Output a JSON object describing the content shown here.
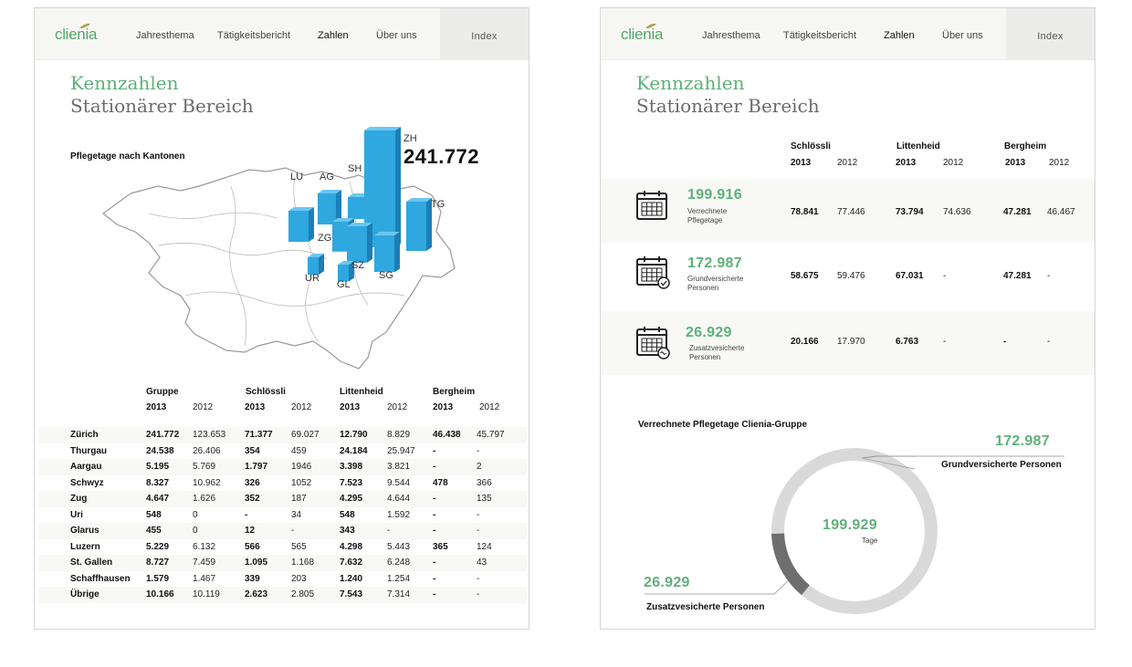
{
  "nav": {
    "logo": "clienia",
    "items": [
      "Jahresthema",
      "Tätigkeitsbericht",
      "Zahlen",
      "Über uns"
    ],
    "active": "Zahlen",
    "index": "Index"
  },
  "title": {
    "line1": "Kennzahlen",
    "line2": "Stationärer Bereich"
  },
  "colors": {
    "accent_green": "#5eb07a",
    "bar_blue": "#2fa7df",
    "donut_light": "#d9d9d9",
    "donut_dark": "#6e6e6e"
  },
  "left": {
    "map_label": "Pflegetage nach Kantonen",
    "map_big_value": "241.772",
    "cantons": [
      "LU",
      "AG",
      "SH",
      "ZH",
      "TG",
      "ZG",
      "UR",
      "SZ",
      "GL",
      "SG"
    ],
    "table": {
      "groups": [
        "Gruppe",
        "Schlössli",
        "Littenheid",
        "Bergheim"
      ],
      "years": [
        "2013",
        "2012"
      ],
      "rows": [
        {
          "name": "Zürich",
          "v": [
            "241.772",
            "123.653",
            "71.377",
            "69.027",
            "12.790",
            "8.829",
            "46.438",
            "45.797"
          ]
        },
        {
          "name": "Thurgau",
          "v": [
            "24.538",
            "26.406",
            "354",
            "459",
            "24.184",
            "25.947",
            "-",
            "-"
          ]
        },
        {
          "name": "Aargau",
          "v": [
            "5.195",
            "5.769",
            "1.797",
            "1946",
            "3.398",
            "3.821",
            "-",
            "2"
          ]
        },
        {
          "name": "Schwyz",
          "v": [
            "8.327",
            "10.962",
            "326",
            "1052",
            "7.523",
            "9.544",
            "478",
            "366"
          ]
        },
        {
          "name": "Zug",
          "v": [
            "4.647",
            "1.626",
            "352",
            "187",
            "4.295",
            "4.644",
            "-",
            "135"
          ]
        },
        {
          "name": "Uri",
          "v": [
            "548",
            "0",
            "-",
            "34",
            "548",
            "1.592",
            "-",
            "-"
          ]
        },
        {
          "name": "Glarus",
          "v": [
            "455",
            "0",
            "12",
            "-",
            "343",
            "-",
            "-",
            "-"
          ]
        },
        {
          "name": "Luzern",
          "v": [
            "5.229",
            "6.132",
            "566",
            "565",
            "4.298",
            "5.443",
            "365",
            "124"
          ]
        },
        {
          "name": "St. Gallen",
          "v": [
            "8.727",
            "7.459",
            "1.095",
            "1.168",
            "7.632",
            "6.248",
            "-",
            "43"
          ]
        },
        {
          "name": "Schaffhausen",
          "v": [
            "1.579",
            "1.467",
            "339",
            "203",
            "1.240",
            "1.254",
            "-",
            "-"
          ]
        },
        {
          "name": "Übrige",
          "v": [
            "10.166",
            "10.119",
            "2.623",
            "2.805",
            "7.543",
            "7.314",
            "-",
            "-"
          ]
        }
      ]
    }
  },
  "right": {
    "groups": [
      "Schlössli",
      "Littenheid",
      "Bergheim"
    ],
    "years": [
      "2013",
      "2012"
    ],
    "kpis": [
      {
        "value": "199.916",
        "label1": "Verrechnete",
        "label2": "Pflegetage",
        "icon": "calendar-icon",
        "v": [
          "78.841",
          "77.446",
          "73.794",
          "74.636",
          "47.281",
          "46.467"
        ]
      },
      {
        "value": "172.987",
        "label1": "Grundversicherte",
        "label2": "Personen",
        "icon": "calendar-check-icon",
        "v": [
          "58.675",
          "59.476",
          "67.031",
          "-",
          "47.281",
          "-"
        ]
      },
      {
        "value": "26.929",
        "label1": "Zusatzvesicherte",
        "label2": "Personen",
        "icon": "calendar-wave-icon",
        "v": [
          "20.166",
          "17.970",
          "6.763",
          "-",
          "-",
          "-"
        ]
      }
    ],
    "donut_title": "Verrechnete Pflegetage Clienia-Gruppe",
    "donut_center_value": "199.929",
    "donut_center_label": "Tage"
  },
  "chart_data": [
    {
      "type": "bar",
      "title": "Pflegetage nach Kantonen",
      "categories": [
        "LU",
        "AG",
        "SH",
        "ZH",
        "TG",
        "ZG",
        "UR",
        "SZ",
        "GL",
        "SG"
      ],
      "values": [
        5229,
        5195,
        1579,
        241772,
        24538,
        4647,
        548,
        8327,
        455,
        8727
      ]
    },
    {
      "type": "pie",
      "title": "Verrechnete Pflegetage Clienia-Gruppe",
      "categories": [
        "Grundversicherte Personen",
        "Zusatzvesicherte Personen"
      ],
      "values": [
        172987,
        26929
      ],
      "labels": [
        "172.987",
        "26.929"
      ],
      "center_value": "199.929",
      "center_label": "Tage"
    }
  ]
}
